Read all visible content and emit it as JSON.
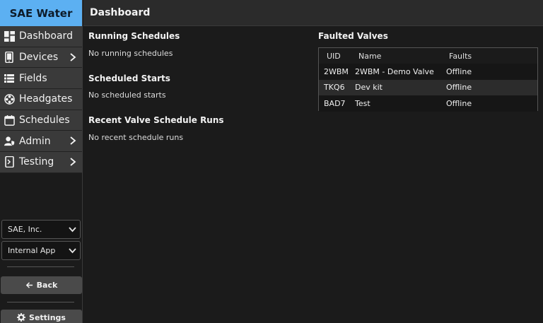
{
  "app": {
    "brand": "SAE Water",
    "page_title": "Dashboard"
  },
  "sidebar": {
    "items": [
      {
        "label": "Dashboard",
        "icon": "dashboard-icon",
        "has_submenu": false
      },
      {
        "label": "Devices",
        "icon": "phone-icon",
        "has_submenu": true
      },
      {
        "label": "Fields",
        "icon": "list-icon",
        "has_submenu": false
      },
      {
        "label": "Headgates",
        "icon": "valve-icon",
        "has_submenu": false
      },
      {
        "label": "Schedules",
        "icon": "calendar-icon",
        "has_submenu": false
      },
      {
        "label": "Admin",
        "icon": "admin-shield-icon",
        "has_submenu": true
      },
      {
        "label": "Testing",
        "icon": "testing-icon",
        "has_submenu": true
      }
    ],
    "org_select": "SAE, Inc.",
    "app_select": "Internal App",
    "back_label": "Back",
    "settings_label": "Settings"
  },
  "main": {
    "running": {
      "title": "Running Schedules",
      "empty": "No running schedules"
    },
    "scheduled": {
      "title": "Scheduled Starts",
      "empty": "No scheduled starts"
    },
    "recent": {
      "title": "Recent Valve Schedule Runs",
      "empty": "No recent schedule runs"
    },
    "faulted": {
      "title": "Faulted Valves",
      "columns": [
        "UID",
        "Name",
        "Faults"
      ],
      "rows": [
        {
          "uid": "2WBM",
          "name": "2WBM - Demo Valve",
          "faults": "Offline"
        },
        {
          "uid": "TKQ6",
          "name": "Dev kit",
          "faults": "Offline"
        },
        {
          "uid": "BAD7",
          "name": "Test",
          "faults": "Offline"
        }
      ]
    }
  },
  "colors": {
    "brand_bg": "#5cb0f2",
    "nav_bg": "#3a3a3a",
    "page_bg": "#1b1b1b"
  }
}
